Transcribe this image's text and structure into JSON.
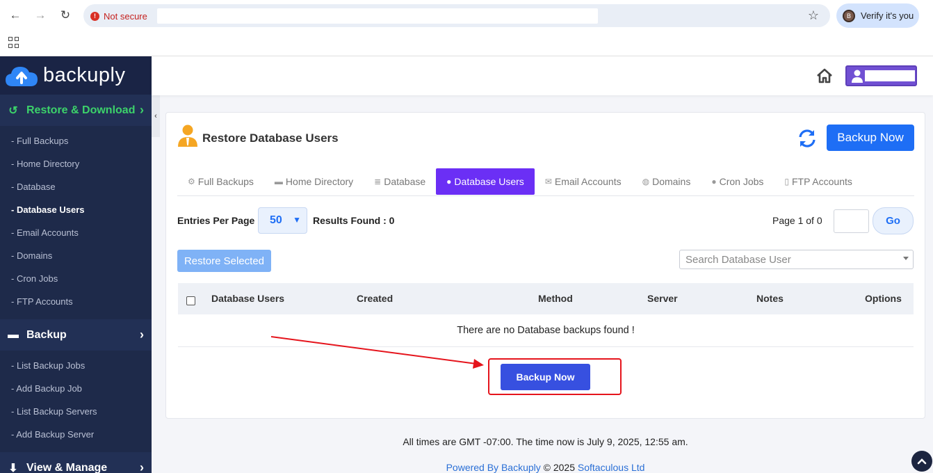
{
  "browser": {
    "security_text": "Not secure",
    "profile_initial": "B",
    "profile_label": "Verify it's you"
  },
  "brand": {
    "name": "backuply"
  },
  "sidebar": {
    "restore_section": "Restore & Download",
    "restore_items": [
      {
        "label": "- Full Backups"
      },
      {
        "label": "- Home Directory"
      },
      {
        "label": "- Database"
      },
      {
        "label": "- Database Users"
      },
      {
        "label": "- Email Accounts"
      },
      {
        "label": "- Domains"
      },
      {
        "label": "- Cron Jobs"
      },
      {
        "label": "- FTP Accounts"
      }
    ],
    "backup_section": "Backup",
    "backup_items": [
      {
        "label": "- List Backup Jobs"
      },
      {
        "label": "- Add Backup Job"
      },
      {
        "label": "- List Backup Servers"
      },
      {
        "label": "- Add Backup Server"
      }
    ],
    "view_section": "View & Manage"
  },
  "panel": {
    "title": "Restore Database Users",
    "backup_now_label": "Backup Now",
    "tabs": [
      {
        "label": "Full Backups",
        "icon": "cogs-icon"
      },
      {
        "label": "Home Directory",
        "icon": "folder-icon"
      },
      {
        "label": "Database",
        "icon": "database-icon"
      },
      {
        "label": "Database Users",
        "icon": "user-tie-icon"
      },
      {
        "label": "Email Accounts",
        "icon": "envelope-icon"
      },
      {
        "label": "Domains",
        "icon": "globe-icon"
      },
      {
        "label": "Cron Jobs",
        "icon": "user-clock-icon"
      },
      {
        "label": "FTP Accounts",
        "icon": "file-icon"
      }
    ],
    "entries_label": "Entries Per Page",
    "entries_value": "50",
    "results_label": "Results Found : 0",
    "page_label": "Page 1 of 0",
    "go_label": "Go",
    "restore_selected_label": "Restore Selected",
    "search_placeholder": "Search Database User",
    "columns": [
      "Database Users",
      "Created",
      "Method",
      "Server",
      "Notes",
      "Options"
    ],
    "empty_message": "There are no Database backups found !",
    "backup_now_bottom_label": "Backup Now"
  },
  "footer": {
    "time_text": "All times are GMT -07:00. The time now is July 9, 2025, 12:55 am.",
    "powered_link": "Powered By Backuply",
    "copyright": " © 2025 ",
    "company_link": "Softaculous Ltd"
  },
  "colors": {
    "sidebar_bg": "#1e2a4a",
    "active_green": "#3cd26a",
    "primary_blue": "#1e6ef5",
    "tab_active_purple": "#6b2ff5",
    "annotation_red": "#e5141c"
  }
}
